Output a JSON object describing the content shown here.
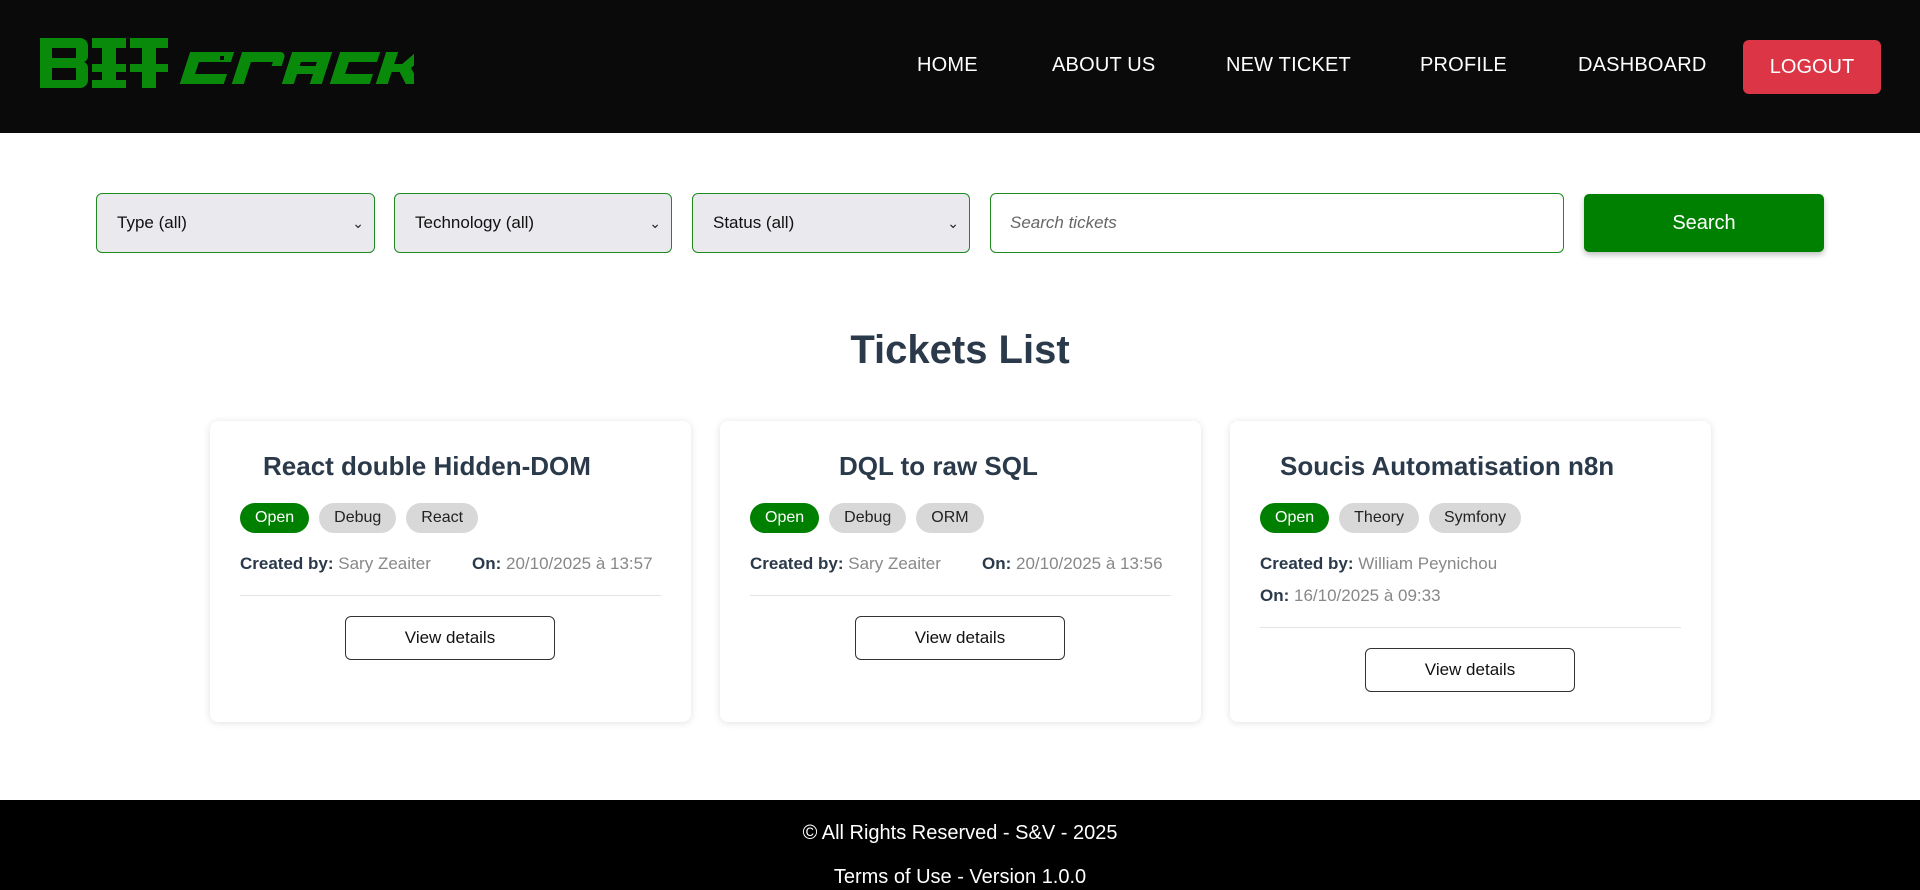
{
  "header": {
    "logo_text": "BIT CRACK",
    "nav": [
      {
        "label": "HOME"
      },
      {
        "label": "ABOUT US"
      },
      {
        "label": "NEW TICKET"
      },
      {
        "label": "PROFILE"
      },
      {
        "label": "DASHBOARD"
      }
    ],
    "logout_label": "LOGOUT"
  },
  "filters": {
    "type_selected": "Type (all)",
    "technology_selected": "Technology (all)",
    "status_selected": "Status (all)",
    "search_placeholder": "Search tickets",
    "search_button": "Search"
  },
  "main": {
    "title": "Tickets List",
    "tickets": [
      {
        "title": "React double Hidden-DOM",
        "status": "Open",
        "tags": [
          "Debug",
          "React"
        ],
        "created_by_label": "Created by:",
        "created_by": "Sary Zeaiter",
        "on_label": "On:",
        "date": "20/10/2025 à 13:57",
        "button": "View details"
      },
      {
        "title": "DQL to raw SQL",
        "status": "Open",
        "tags": [
          "Debug",
          "ORM"
        ],
        "created_by_label": "Created by:",
        "created_by": "Sary Zeaiter",
        "on_label": "On:",
        "date": "20/10/2025 à 13:56",
        "button": "View details"
      },
      {
        "title": "Soucis Automatisation n8n",
        "status": "Open",
        "tags": [
          "Theory",
          "Symfony"
        ],
        "created_by_label": "Created by:",
        "created_by": "William Peynichou",
        "on_label": "On:",
        "date": "16/10/2025 à 09:33",
        "button": "View details"
      }
    ]
  },
  "footer": {
    "copyright": "© All Rights Reserved - S&V - 2025",
    "terms": "Terms of Use",
    "separator": " - ",
    "version": "Version 1.0.0"
  },
  "colors": {
    "brand_green": "#008000",
    "logout_red": "#dc3545",
    "header_bg": "#0a0a0a",
    "title_color": "#2b3a4a"
  }
}
